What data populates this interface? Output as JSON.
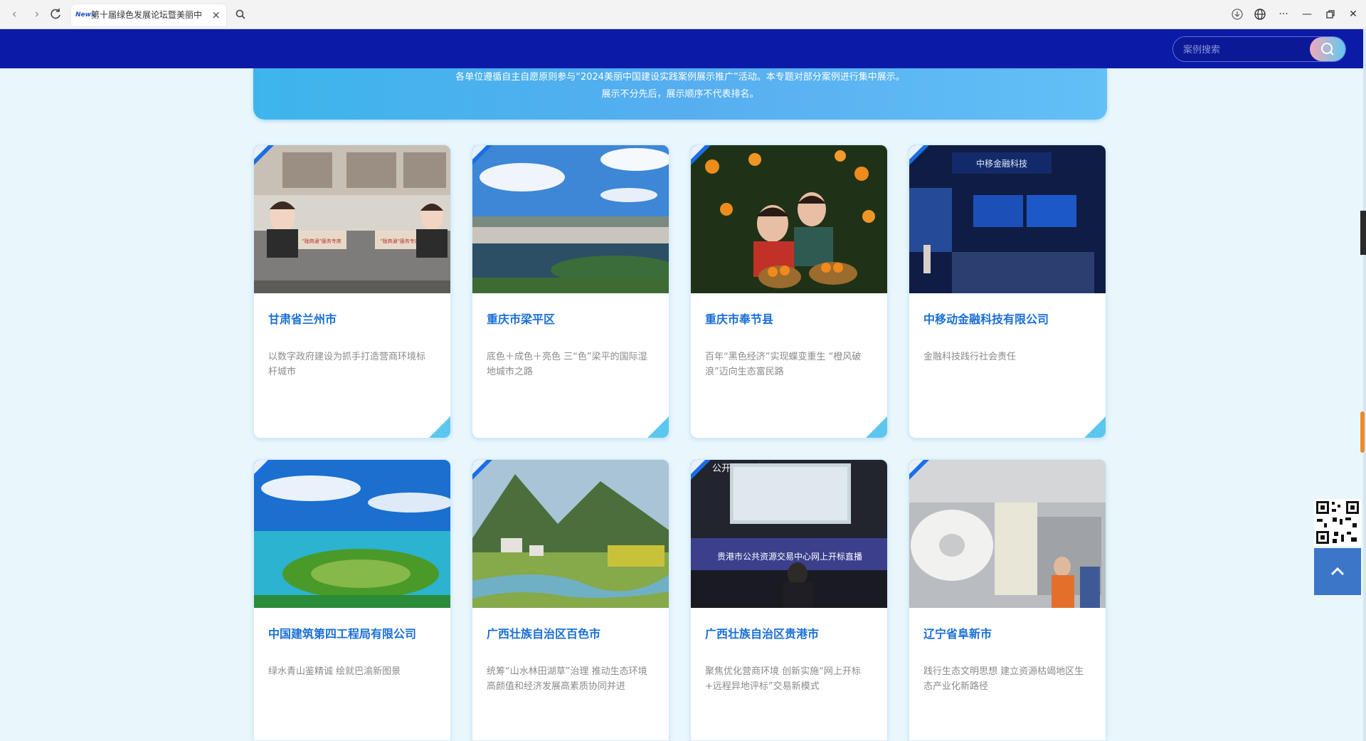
{
  "browser": {
    "tab_favicon": "News",
    "tab_title": "第十届绿色发展论坛暨美丽中",
    "tab_close": "×"
  },
  "header": {
    "search_placeholder": "案例搜索"
  },
  "banner": {
    "line1": "各单位遵循自主自愿原则参与“2024美丽中国建设实践案例展示推广”活动。本专题对部分案例进行集中展示。",
    "line2": "展示不分先后，展示顺序不代表排名。"
  },
  "cards": [
    {
      "title": "甘肃省兰州市",
      "desc": "以数字政府建设为抓手打造营商环境标杆城市",
      "image": "call-center-photo"
    },
    {
      "title": "重庆市梁平区",
      "desc": "底色＋成色＋亮色 三“色”梁平的国际湿地城市之路",
      "image": "wetland-city-photo"
    },
    {
      "title": "重庆市奉节县",
      "desc": "百年“黑色经济”实现蝶变重生 “橙风破浪”迈向生态富民路",
      "image": "orange-harvest-photo"
    },
    {
      "title": "中移动金融科技有限公司",
      "desc": "金融科技践行社会责任",
      "image": "fintech-expo-photo"
    },
    {
      "title": "中国建筑第四工程局有限公司",
      "desc": "绿水青山鉴精诚 绘就巴渝新图景",
      "image": "river-island-photo"
    },
    {
      "title": "广西壮族自治区百色市",
      "desc": "统筹“山水林田湖草”治理 推动生态环境高颜值和经济发展高素质协同并进",
      "image": "valley-fields-photo"
    },
    {
      "title": "广西壮族自治区贵港市",
      "desc": "聚焦优化营商环境 创新实施“网上开标+远程异地评标”交易新模式",
      "image": "bidding-hall-photo"
    },
    {
      "title": "辽宁省阜新市",
      "desc": "践行生态文明思想 建立资源枯竭地区生态产业化新路径",
      "image": "paper-factory-photo"
    }
  ],
  "photo_text": {
    "card0_sign": "\"陇商通\"服务专席",
    "card3_sign": "中移金融科技",
    "card6_banner": "贵港市公共资源交易中心网上开标直播",
    "card6_wall": "公开 公正 高效"
  },
  "icons": [
    "back-arrow-icon",
    "forward-arrow-icon",
    "reload-icon",
    "search-icon",
    "download-icon",
    "globe-icon",
    "more-icon",
    "minimize-icon",
    "restore-icon",
    "close-icon",
    "qr-code-icon",
    "chevron-up-icon"
  ]
}
